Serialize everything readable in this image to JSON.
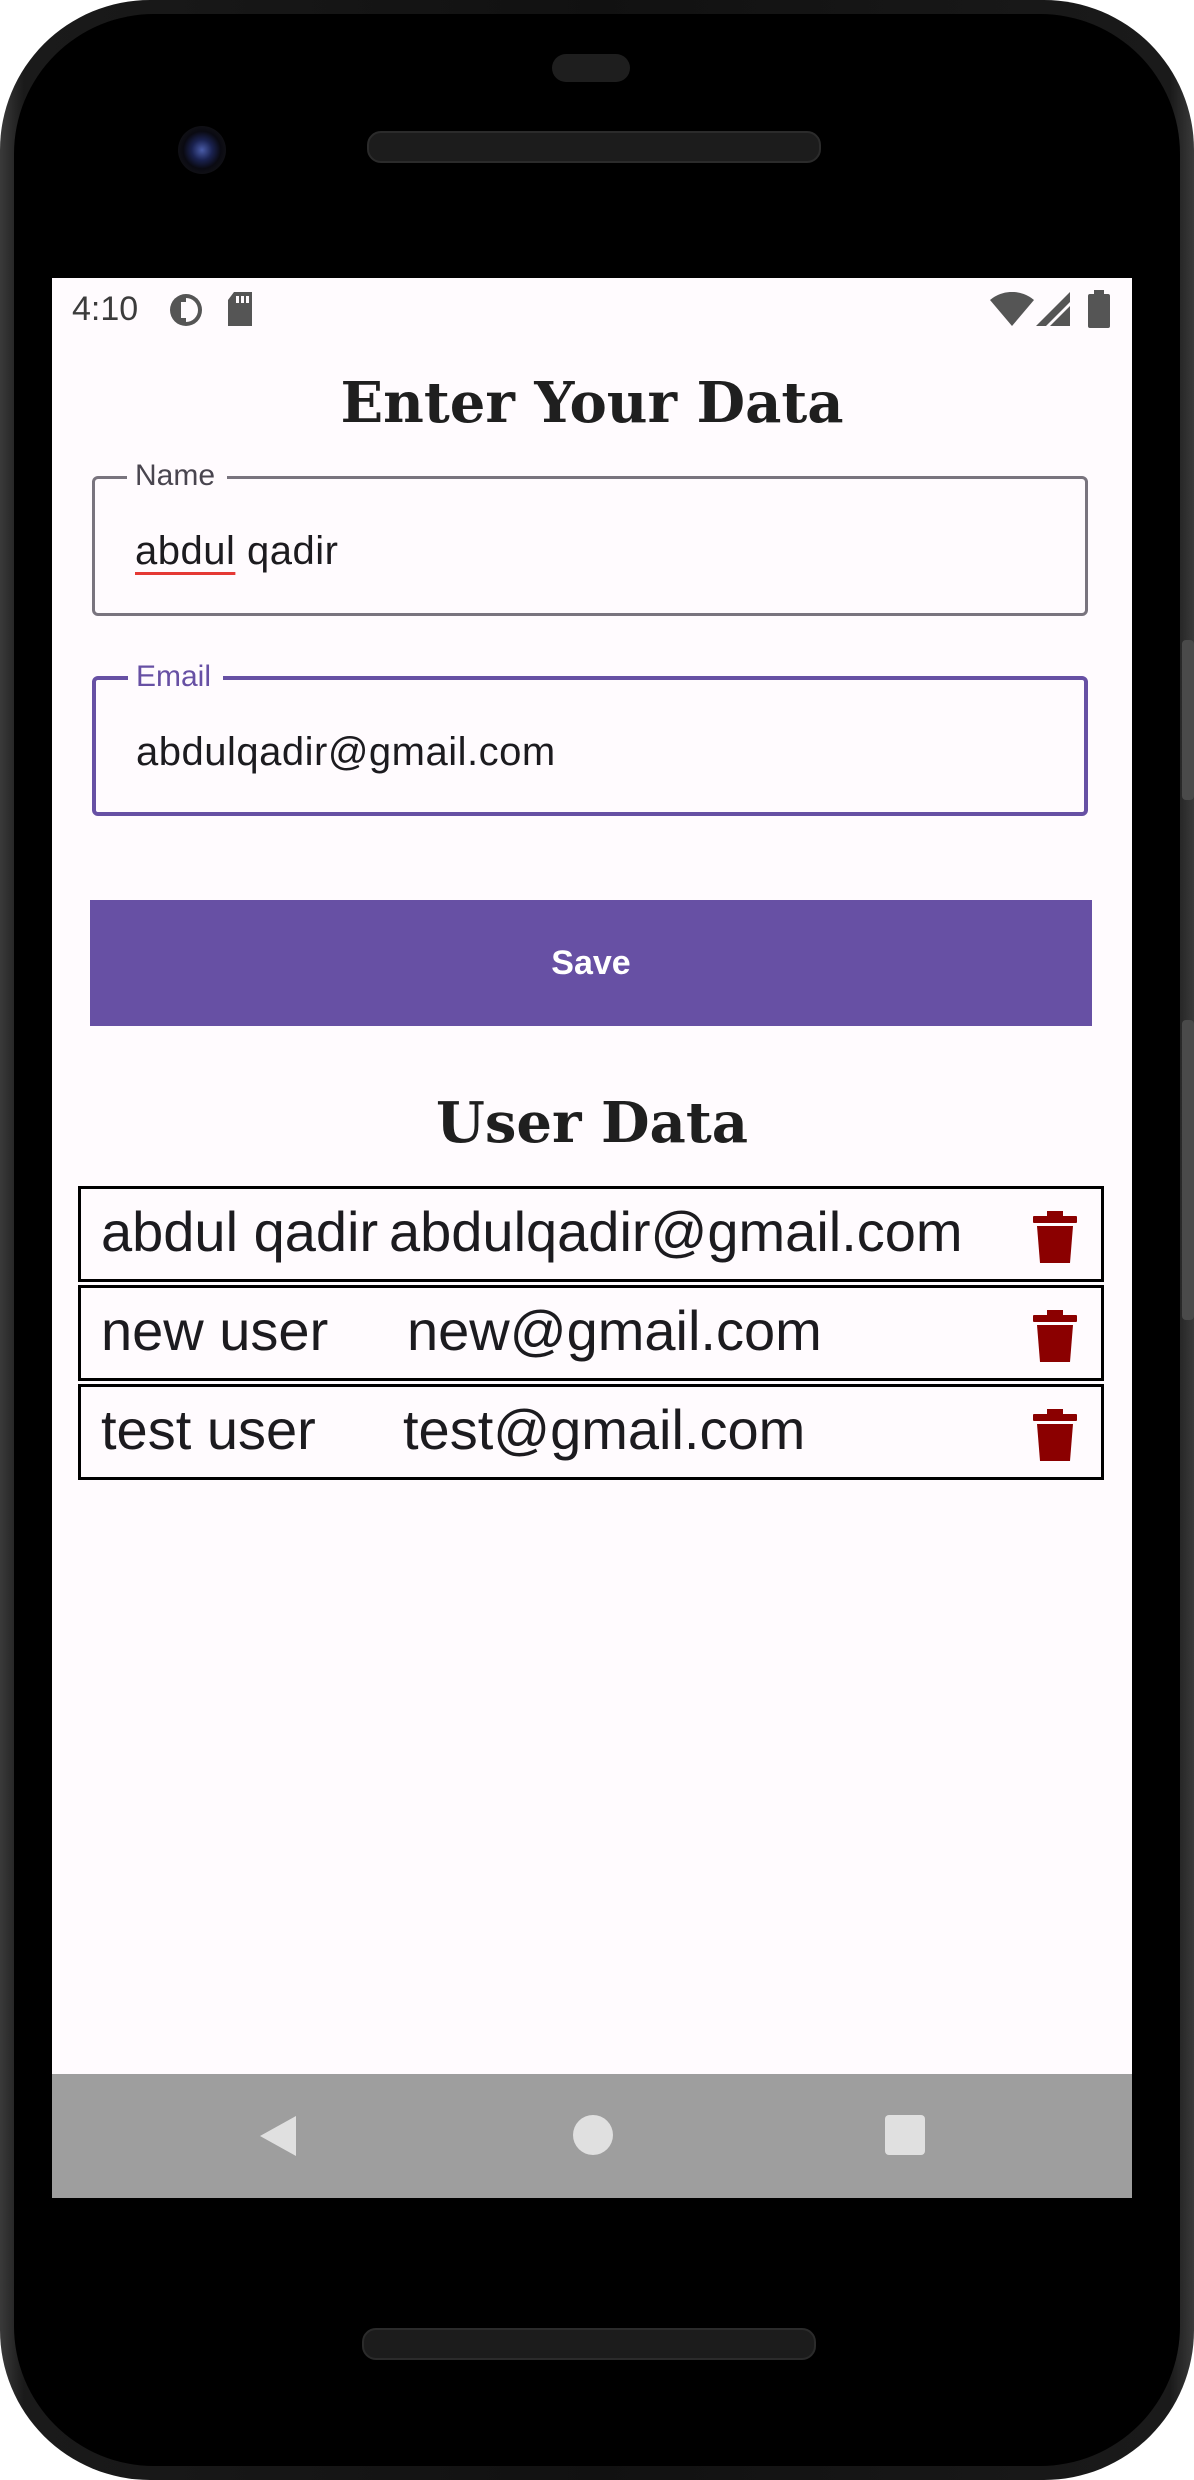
{
  "status_bar": {
    "time": "4:10",
    "icons_left": [
      "data-saver-icon",
      "sd-card-icon"
    ],
    "icons_right": [
      "wifi-icon",
      "cell-signal-icon",
      "battery-icon"
    ]
  },
  "form": {
    "title": "Enter Your Data",
    "name_label": "Name",
    "name_value_misspelled": "abdul",
    "name_value_rest": " qadir",
    "email_label": "Email",
    "email_value": "abdulqadir@gmail.com",
    "save_label": "Save"
  },
  "users": {
    "title": "User Data",
    "rows": [
      {
        "name": "abdul qadir",
        "email": "abdulqadir@gmail.com"
      },
      {
        "name": "new user",
        "email": "new@gmail.com"
      },
      {
        "name": "test user",
        "email": "test@gmail.com"
      }
    ]
  },
  "nav": {
    "icons": [
      "back-triangle-icon",
      "home-circle-icon",
      "recents-square-icon"
    ]
  },
  "colors": {
    "accent": "#6750a4",
    "delete": "#8b0000",
    "background": "#fffbfe",
    "nav_bar": "#9e9e9e"
  }
}
